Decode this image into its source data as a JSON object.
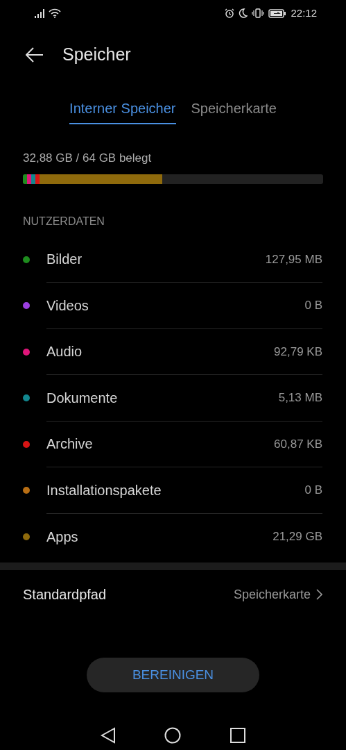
{
  "status_bar": {
    "time": "22:12"
  },
  "header": {
    "title": "Speicher"
  },
  "tabs": [
    {
      "label": "Interner Speicher",
      "selected": true
    },
    {
      "label": "Speicherkarte",
      "selected": false
    }
  ],
  "usage": {
    "text": "32,88 GB / 64 GB belegt",
    "segments": [
      {
        "color": "#1e8c1e"
      },
      {
        "color": "#e0157a"
      },
      {
        "color": "#12878f"
      },
      {
        "color": "#d71414"
      },
      {
        "color": "#8f6a0c"
      }
    ]
  },
  "section_title": "NUTZERDATEN",
  "categories": [
    {
      "name": "Bilder",
      "size": "127,95 MB",
      "color": "#1e8c1e"
    },
    {
      "name": "Videos",
      "size": "0 B",
      "color": "#9b3fe0"
    },
    {
      "name": "Audio",
      "size": "92,79 KB",
      "color": "#e0157a"
    },
    {
      "name": "Dokumente",
      "size": "5,13 MB",
      "color": "#12878f"
    },
    {
      "name": "Archive",
      "size": "60,87 KB",
      "color": "#d71414"
    },
    {
      "name": "Installationspakete",
      "size": "0 B",
      "color": "#b86e14"
    },
    {
      "name": "Apps",
      "size": "21,29 GB",
      "color": "#8f6a0c"
    }
  ],
  "default_path": {
    "label": "Standardpfad",
    "value": "Speicherkarte"
  },
  "button": "BEREINIGEN"
}
